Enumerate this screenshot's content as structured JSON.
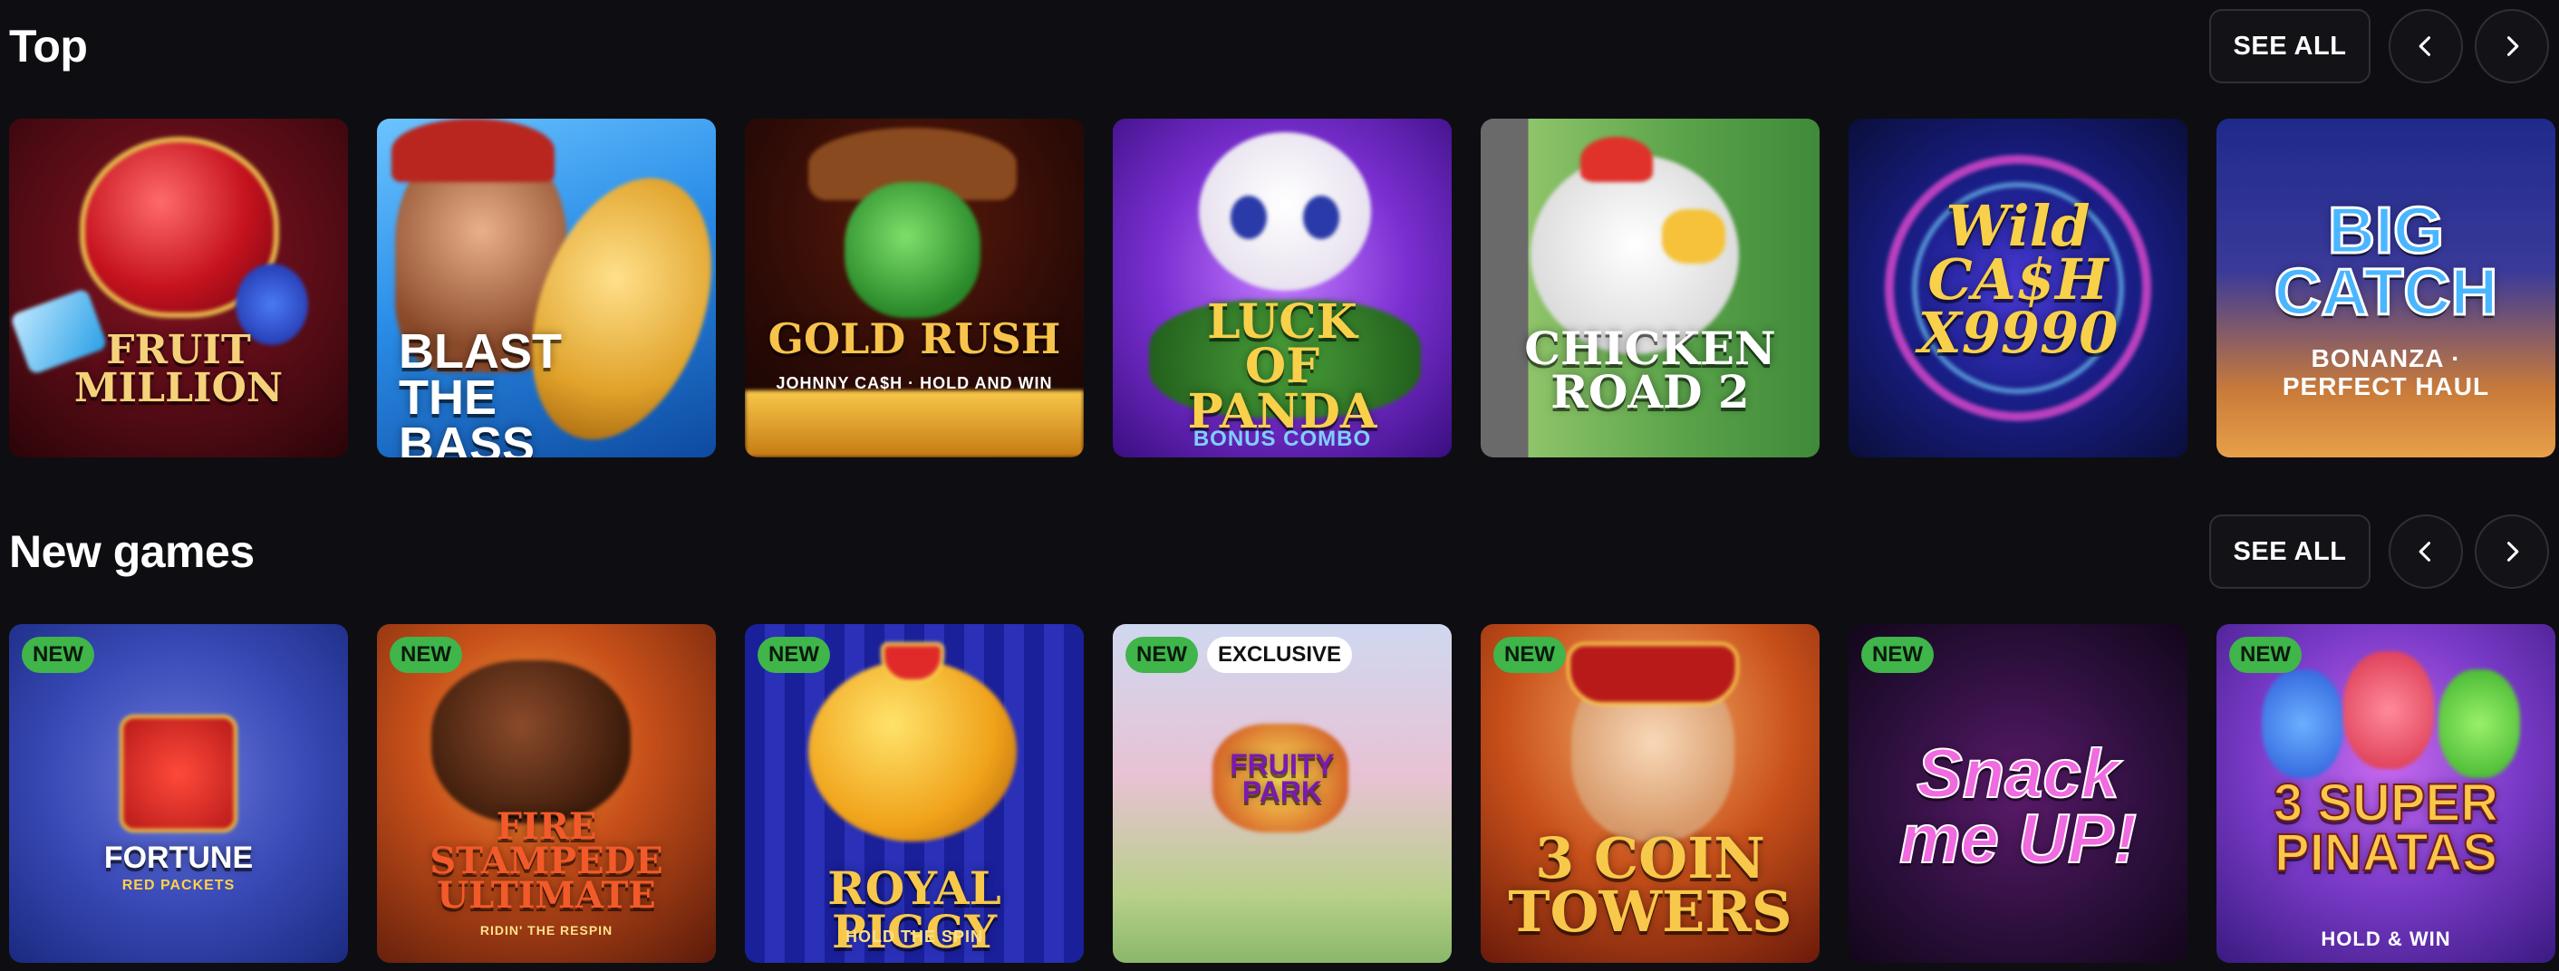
{
  "sections": {
    "top": {
      "title": "Top",
      "see_all": "SEE ALL",
      "prev_icon": "chevron-left-icon",
      "next_icon": "chevron-right-icon",
      "games": [
        {
          "title": "FRUIT MILLION",
          "subtitle": "",
          "bg": "#5a0a14",
          "accent": "#e8252f"
        },
        {
          "title": "BLAST THE BASS",
          "subtitle": "",
          "bg": "#2a8de8",
          "accent": "#f6c33a"
        },
        {
          "title": "GOLD RUSH",
          "subtitle": "JOHNNY CA$H · HOLD AND WIN",
          "bg": "#2a0f0a",
          "accent": "#f3a323"
        },
        {
          "title": "LUCK OF PANDA",
          "subtitle": "BONUS COMBO",
          "bg": "#7a2fd1",
          "accent": "#f5c842"
        },
        {
          "title": "CHICKEN ROAD 2",
          "subtitle": "",
          "bg": "#5aa34a",
          "accent": "#f4f4f4"
        },
        {
          "title": "Wild CA$H X9990",
          "subtitle": "",
          "bg": "#151a66",
          "accent": "#f3c93a"
        },
        {
          "title": "BIG CATCH",
          "subtitle": "BONANZA · PERFECT HAUL",
          "bg": "#27307a",
          "accent": "#3aa3f3"
        }
      ]
    },
    "new": {
      "title": "New games",
      "see_all": "SEE ALL",
      "prev_icon": "chevron-left-icon",
      "next_icon": "chevron-right-icon",
      "badge_new": "NEW",
      "badge_exclusive": "EXCLUSIVE",
      "games": [
        {
          "title": "FORTUNE",
          "subtitle": "RED PACKETS",
          "bg": "#2a3aa8",
          "accent": "#d8252a",
          "exclusive": false
        },
        {
          "title": "FIRE STAMPEDE ULTIMATE",
          "subtitle": "RIDIN' THE RESPIN",
          "bg": "#8a2a10",
          "accent": "#f28a1f",
          "exclusive": false
        },
        {
          "title": "ROYAL PIGGY",
          "subtitle": "HOLD THE SPIN",
          "bg": "#1a1f8a",
          "accent": "#f5b32a",
          "exclusive": false
        },
        {
          "title": "FRUITY PARK",
          "subtitle": "",
          "bg": "#e8b7c7",
          "accent": "#8a2ab0",
          "exclusive": true
        },
        {
          "title": "3 COIN TOWERS",
          "subtitle": "",
          "bg": "#a8401a",
          "accent": "#f3b52a",
          "exclusive": false
        },
        {
          "title": "Snack me UP!",
          "subtitle": "",
          "bg": "#2a0f3a",
          "accent": "#e94bd3",
          "exclusive": false
        },
        {
          "title": "3 SUPER PINATAS",
          "subtitle": "HOLD & WIN",
          "bg": "#7a3ac8",
          "accent": "#f3c83a",
          "exclusive": false
        }
      ]
    }
  }
}
